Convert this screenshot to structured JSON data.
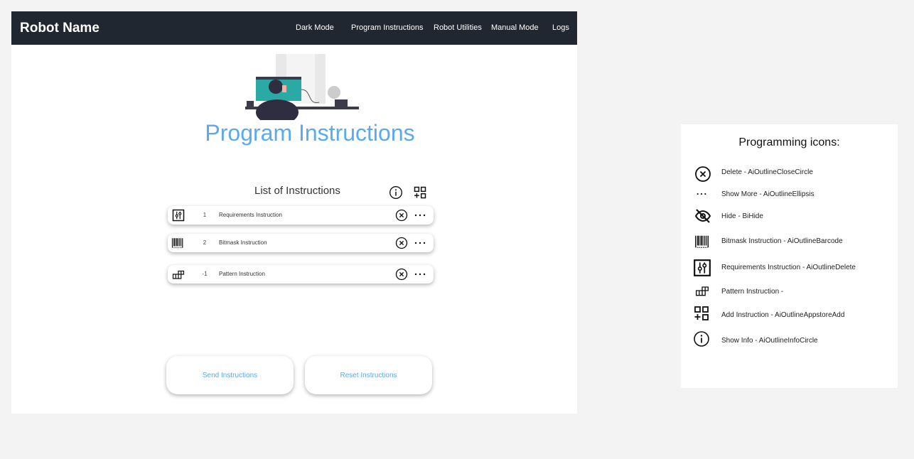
{
  "navbar": {
    "brand": "Robot Name",
    "items": [
      "Dark Mode",
      "Program Instructions",
      "Robot Utilities",
      "Manual Mode",
      "Logs"
    ]
  },
  "page_title": "Program Instructions",
  "list": {
    "title": "List of Instructions",
    "rows": [
      {
        "icon": "requirements-icon",
        "number": "1",
        "label": "Requirements Instruction"
      },
      {
        "icon": "barcode-icon",
        "number": "2",
        "label": "Bitmask Instruction"
      },
      {
        "icon": "pattern-icon",
        "number": "-1",
        "label": "Pattern Instruction"
      }
    ]
  },
  "buttons": {
    "send": "Send Instructions",
    "reset": "Reset Instructions"
  },
  "legend": {
    "title": "Programming icons:",
    "items": [
      "Delete - AiOutlineCloseCircle",
      "Show More - AiOutlineEllipsis",
      "Hide - BiHide",
      "Bitmask Instruction - AiOutlineBarcode",
      "Requirements Instruction - AiOutlineDelete",
      "Pattern Instruction -",
      "Add Instruction - AiOutlineAppstoreAdd",
      "Show Info - AiOutlineInfoCircle"
    ]
  },
  "colors": {
    "navbar": "#212731",
    "accent": "#5ba9ee"
  }
}
